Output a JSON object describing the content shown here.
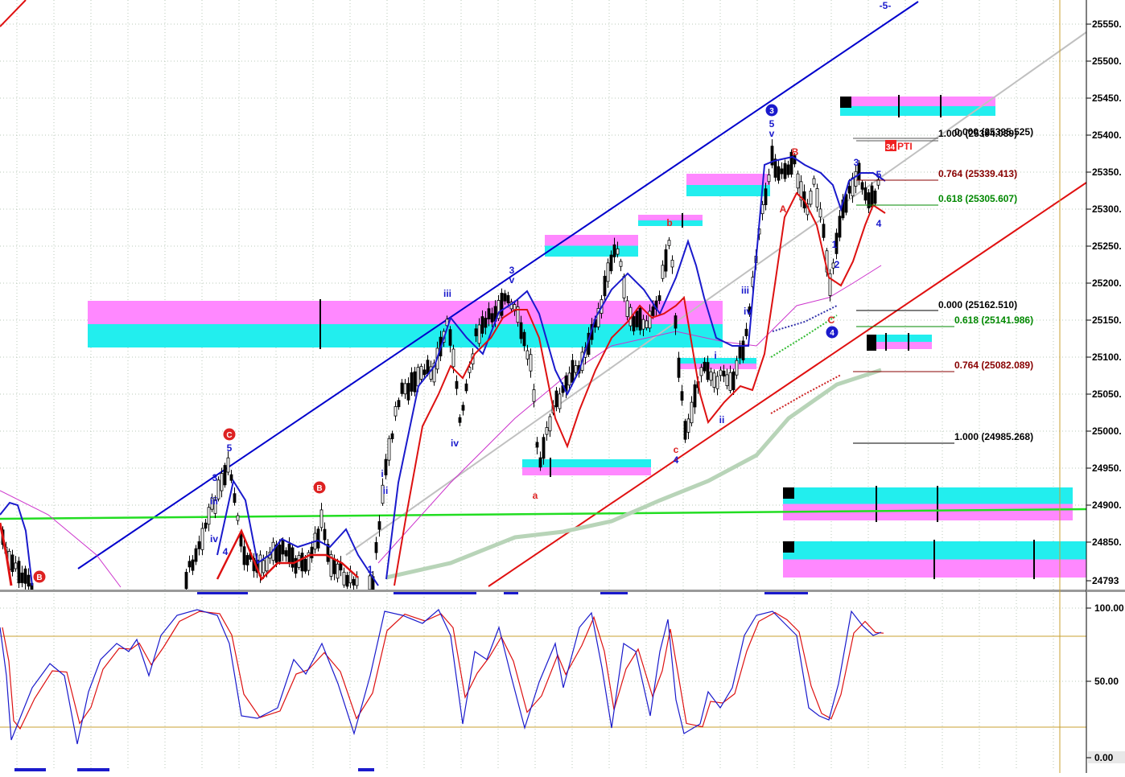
{
  "price_axis": {
    "labels": [
      "25550.",
      "25500.",
      "25450.",
      "25400.",
      "25350.",
      "25300.",
      "25250.",
      "25200.",
      "25150.",
      "25100.",
      "25050.",
      "25000.",
      "24950.",
      "24900.",
      "24850.",
      "24793"
    ]
  },
  "indicator_axis": {
    "labels": [
      "100.00",
      "50.00",
      "0.00"
    ]
  },
  "fib_upper": {
    "label_a": "1.000 (25394.039)",
    "label_b": "0.000 (25395.525)",
    "label_764": "0.764 (25339.413)",
    "label_618": "0.618 (25305.607)"
  },
  "fib_lower": {
    "label_000": "0.000 (25162.510)",
    "label_618": "0.618 (25141.986)",
    "label_764": "0.764 (25082.089)",
    "label_1000": "1.000 (24985.268)"
  },
  "pti_badge": {
    "number": "34",
    "text": "PTI"
  },
  "wave_labels": {
    "w1": "1",
    "w2": "2",
    "w3": "3",
    "w4": "4",
    "w5": "5",
    "i": "i",
    "ii": "ii",
    "iii": "iii",
    "iv": "iv",
    "v": "v",
    "a": "a",
    "b": "b",
    "c": "c",
    "A": "A",
    "B": "B",
    "C": "C",
    "top_channel": "-5-"
  },
  "colors": {
    "up_channel": "#0000cc",
    "down_channel": "#e01010",
    "gray_channel": "#c0c0c0",
    "green_line": "#22dd22",
    "ma_gray_green": "#b8d4b8",
    "zone_magenta": "#ff88ff",
    "zone_cyan": "#22eeee",
    "stoch_k": "#1a1acc",
    "stoch_d": "#dd1111",
    "ref_line": "#c8a030"
  }
}
